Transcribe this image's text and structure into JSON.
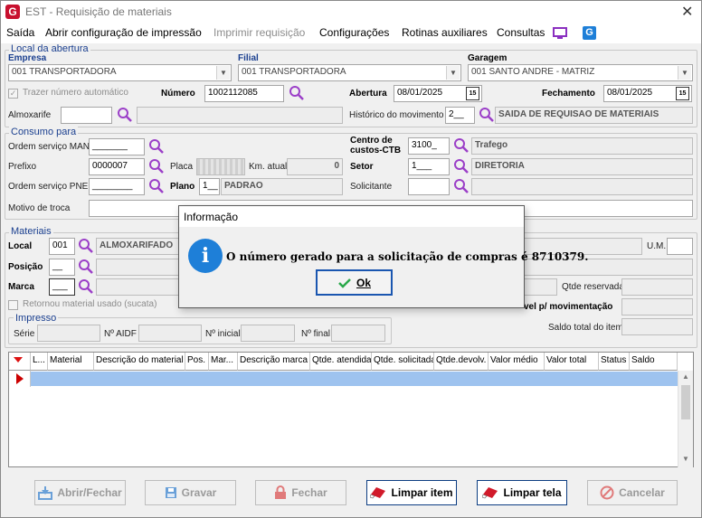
{
  "window": {
    "title": "EST - Requisição de materiais",
    "app_icon_letter": "G"
  },
  "menu": {
    "items": [
      "Saída",
      "Abrir configuração de impressão",
      "Imprimir requisição",
      "Configurações",
      "Rotinas auxiliares",
      "Consultas"
    ]
  },
  "local_abertura": {
    "title": "Local da abertura",
    "empresa_label": "Empresa",
    "empresa_value": "001 TRANSPORTADORA",
    "filial_label": "Filial",
    "filial_value": "001 TRANSPORTADORA",
    "garagem_label": "Garagem",
    "garagem_value": "001 SANTO ANDRE - MATRIZ",
    "trazer_numero_label": "Trazer número automático",
    "numero_label": "Número",
    "numero_value": "1002112085",
    "abertura_label": "Abertura",
    "abertura_value": "08/01/2025",
    "fechamento_label": "Fechamento",
    "fechamento_value": "08/01/2025",
    "almoxarife_label": "Almoxarife",
    "historico_label": "Histórico do movimento",
    "historico_code": "2__",
    "historico_desc": "SAIDA DE REQUISAO DE MATERIAIS",
    "calendar_icon_text": "15"
  },
  "consumo": {
    "title": "Consumo para",
    "os_man_label": "Ordem serviço MAN",
    "os_man_value": "_______",
    "centro_label_1": "Centro de",
    "centro_label_2": "custos-CTB",
    "centro_code": "3100_",
    "centro_desc": "Trafego",
    "prefixo_label": "Prefixo",
    "prefixo_value": "0000007",
    "placa_label": "Placa",
    "km_label": "Km. atual",
    "km_value": "0",
    "setor_label": "Setor",
    "setor_code": "1___",
    "setor_desc": "DIRETORIA",
    "os_pne_label": "Ordem serviço PNE",
    "os_pne_value": "________",
    "plano_label": "Plano",
    "plano_code": "1__",
    "plano_desc": "PADRAO",
    "solicitante_label": "Solicitante",
    "motivo_label": "Motivo de troca"
  },
  "materiais": {
    "title": "Materiais",
    "local_label": "Local",
    "local_code": "001",
    "local_desc": "ALMOXARIFADO",
    "um_label": "U.M.",
    "posicao_label": "Posição",
    "posicao_code": "__",
    "marca_label": "Marca",
    "marca_code": "___",
    "qtde_reservada_label": "Qtde reservada",
    "retornou_label": "Retornou material usado (sucata)",
    "disp_label": "vel p/ movimentação",
    "saldo_label": "Saldo total do item",
    "impresso_title": "Impresso",
    "serie_label": "Série",
    "aidf_label": "Nº AIDF",
    "inicial_label": "Nº inicial",
    "final_label": "Nº final"
  },
  "grid": {
    "columns": [
      "L...",
      "Material",
      "Descrição do material",
      "Pos.",
      "Mar...",
      "Descrição marca",
      "Qtde. atendida",
      "Qtde. solicitada",
      "Qtde.devolv.",
      "Valor médio",
      "Valor total",
      "Status",
      "Saldo"
    ]
  },
  "buttons": {
    "abrir_fechar": "Abrir/Fechar",
    "gravar": "Gravar",
    "fechar": "Fechar",
    "limpar_item": "Limpar item",
    "limpar_tela": "Limpar tela",
    "cancelar": "Cancelar"
  },
  "dialog": {
    "title": "Informação",
    "message": "O número gerado para a solicitação de compras é  8710379.",
    "ok_label": "Ok",
    "info_glyph": "i"
  },
  "colors": {
    "accent_blue": "#1a3f8f",
    "lookup_purple": "#9b3fc8",
    "selection": "#9ec3ef",
    "info_blue": "#1e7fd8"
  }
}
